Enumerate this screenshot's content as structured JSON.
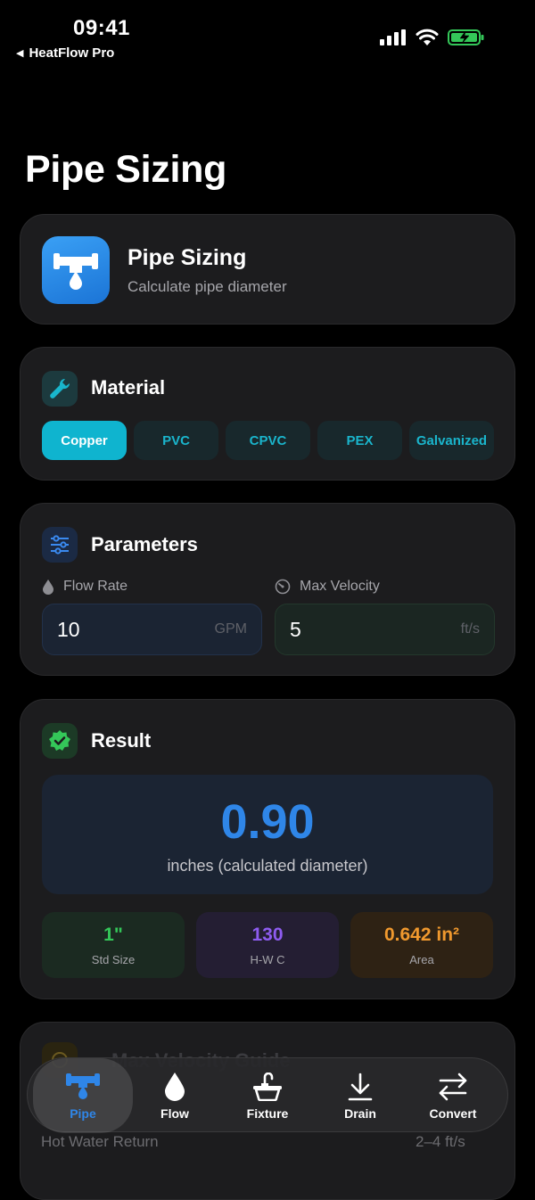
{
  "status_bar": {
    "time": "09:41",
    "back_label": "HeatFlow Pro"
  },
  "page": {
    "title": "Pipe Sizing"
  },
  "header_card": {
    "title": "Pipe Sizing",
    "subtitle": "Calculate pipe diameter"
  },
  "material": {
    "title": "Material",
    "options": [
      "Copper",
      "PVC",
      "CPVC",
      "PEX",
      "Galvanized"
    ],
    "selected": "Copper"
  },
  "parameters": {
    "title": "Parameters",
    "flow_rate": {
      "label": "Flow Rate",
      "value": "10",
      "unit": "GPM"
    },
    "max_velocity": {
      "label": "Max Velocity",
      "value": "5",
      "unit": "ft/s"
    }
  },
  "result": {
    "title": "Result",
    "value": "0.90",
    "caption": "inches (calculated diameter)",
    "stats": [
      {
        "value": "1\"",
        "label": "Std Size"
      },
      {
        "value": "130",
        "label": "H-W C"
      },
      {
        "value": "0.642 in²",
        "label": "Area"
      }
    ]
  },
  "velocity_guide": {
    "title": "Max Velocity Guide",
    "rows": [
      {
        "label": "Hot Water Return",
        "value": "2–4 ft/s"
      }
    ]
  },
  "tab_bar": {
    "tabs": [
      {
        "label": "Pipe",
        "icon": "pipe-icon"
      },
      {
        "label": "Flow",
        "icon": "drop-icon"
      },
      {
        "label": "Fixture",
        "icon": "sink-icon"
      },
      {
        "label": "Drain",
        "icon": "drain-arrow-icon"
      },
      {
        "label": "Convert",
        "icon": "convert-arrows-icon"
      }
    ],
    "active": "Pipe"
  },
  "colors": {
    "accent_teal": "#0fb4cf",
    "result_blue": "#2f86e8",
    "green": "#34c759",
    "purple": "#8e5cf0",
    "orange": "#f0992e"
  }
}
